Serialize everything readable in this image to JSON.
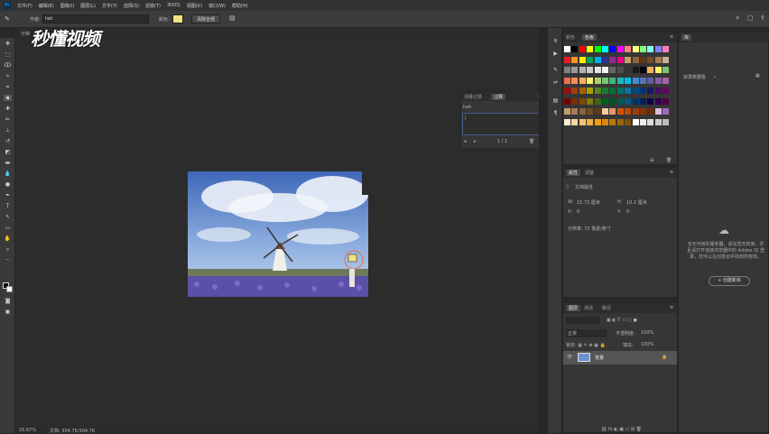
{
  "menu": [
    "文件(F)",
    "编辑(E)",
    "图像(I)",
    "图层(L)",
    "文字(Y)",
    "选择(S)",
    "滤镜(T)",
    "3D(D)",
    "视图(V)",
    "窗口(W)",
    "帮助(H)"
  ],
  "options": {
    "author_label": "作者:",
    "author_value": "hah",
    "color_label": "颜色:",
    "color_value": "#f2e27a",
    "clear_button": "清除全部"
  },
  "watermark": "秒懂视频",
  "doc_tab": "分钟",
  "notes_panel": {
    "tabs": [
      "测量记录",
      "注释"
    ],
    "author": "hah",
    "body": "|",
    "page": "1 / 1"
  },
  "color_panel": {
    "tabs": [
      "颜色",
      "色板"
    ]
  },
  "props_panel": {
    "tabs": [
      "属性",
      "调整"
    ],
    "section": "文档属性",
    "w_label": "W:",
    "w_value": "15.73 厘米",
    "h_label": "H:",
    "h_value": "10.2 厘米",
    "x_label": "X:",
    "x_value": "0",
    "y_label": "Y:",
    "y_value": "0",
    "resolution": "分辨率: 72 像素/英寸"
  },
  "layers_panel": {
    "tabs": [
      "图层",
      "通道",
      "路径"
    ],
    "kind": "正常",
    "opacity_label": "不透明度:",
    "opacity": "100%",
    "fill_label": "填充:",
    "fill": "100%",
    "layer_name": "背景"
  },
  "library": {
    "tab": "库",
    "dropdown": "目录数据看",
    "message": "当无可用的服务器，请勾选无的库，并且请打开连接浏览器中的 Adobe ID 登录，您可以在创意云中找到所有库。",
    "create_button": "+ 创建新库"
  },
  "status": {
    "zoom": "16.67%",
    "doc_info": "文档: 304.7K/304.7K"
  }
}
